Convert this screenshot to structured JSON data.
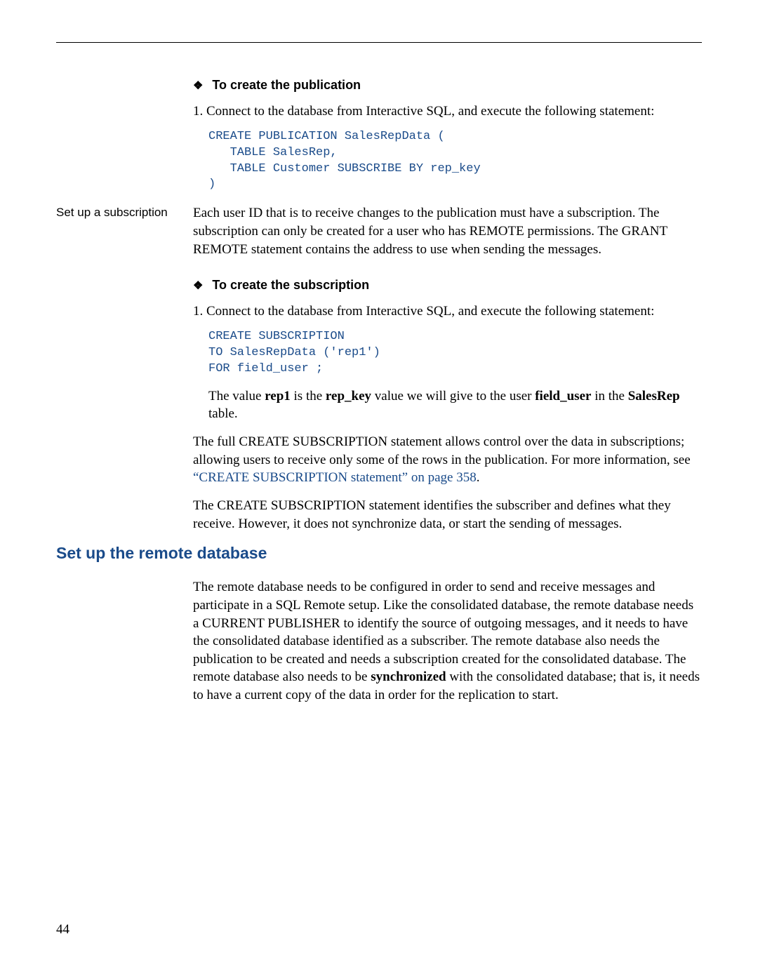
{
  "sec1": {
    "heading": "To create the publication",
    "step1": "1.  Connect to the database from Interactive SQL, and execute the following statement:",
    "code": "CREATE PUBLICATION SalesRepData (\n   TABLE SalesRep,\n   TABLE Customer SUBSCRIBE BY rep_key\n)"
  },
  "sub": {
    "margin_label": "Set up a subscription",
    "para": "Each user ID that is to receive changes to the publication must have a subscription. The subscription can only be created for a user who has REMOTE permissions. The GRANT REMOTE statement contains the address to use when sending the messages."
  },
  "sec2": {
    "heading": "To create the subscription",
    "step1": "1.  Connect to the database from Interactive SQL, and execute the following statement:",
    "code": "CREATE SUBSCRIPTION\nTO SalesRepData ('rep1')\nFOR field_user ;",
    "val_text_pre": "The value ",
    "val_rep1": "rep1",
    "val_mid1": " is the ",
    "val_repkey": "rep_key",
    "val_mid2": " value we will give to the user ",
    "val_fielduser": "field_user",
    "val_mid3": " in the ",
    "val_salesrep": "SalesRep",
    "val_end": " table."
  },
  "full1_pre": "The full CREATE SUBSCRIPTION statement allows control over the data in subscriptions; allowing users to receive only some of the rows in the publication. For more information, see ",
  "full1_link": "“CREATE SUBSCRIPTION statement” on page 358",
  "full1_post": ".",
  "full2": "The CREATE SUBSCRIPTION statement identifies the subscriber and defines what they receive. However, it does not synchronize data, or start the sending of messages.",
  "remote": {
    "heading": "Set up the remote database",
    "para_pre": "The remote database needs to be configured in order to send and receive messages and participate in a SQL Remote setup. Like the consolidated database, the remote database needs a CURRENT PUBLISHER to identify the source of outgoing messages, and it needs to have the consolidated database identified as a subscriber. The remote database also needs the publication to be created and needs a subscription created for the consolidated database. The remote database also needs to be ",
    "para_bold": "synchronized",
    "para_post": " with the consolidated database; that is, it needs to have a current copy of the data in order for the replication to start."
  },
  "page_number": "44"
}
